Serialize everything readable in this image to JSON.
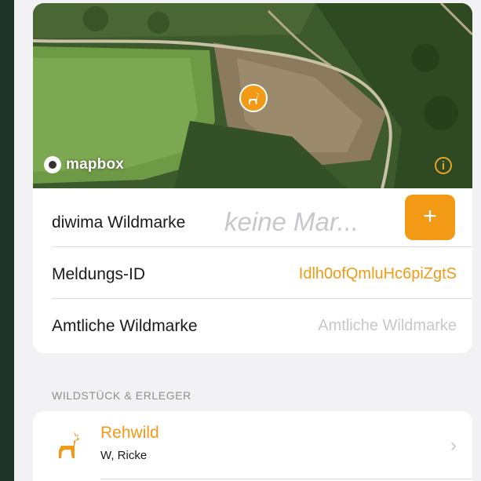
{
  "map": {
    "attribution_logo": "mapbox",
    "marker_icon": "deer-icon",
    "info_icon": "info-icon"
  },
  "fields": {
    "wildmarke_label": "diwima Wildmarke",
    "wildmarke_placeholder": "keine Mar...",
    "add_button_label": "+",
    "meldungs_label": "Meldungs-ID",
    "meldungs_value": "Idlh0ofQmluHc6piZgtS",
    "amtliche_label": "Amtliche Wildmarke",
    "amtliche_placeholder": "Amtliche Wildmarke"
  },
  "section": {
    "header": "WILDSTÜCK & ERLEGER"
  },
  "game": {
    "title": "Rehwild",
    "subtitle": "W, Ricke",
    "chevron": "›"
  },
  "colors": {
    "accent": "#f29a16",
    "background": "#f2f2f5",
    "outer": "#1e3327"
  }
}
